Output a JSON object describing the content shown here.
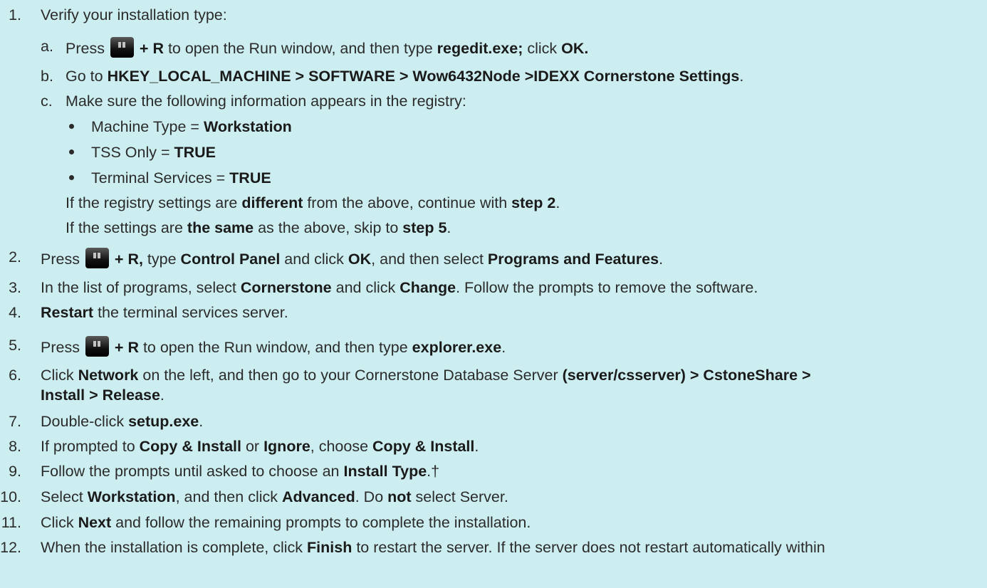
{
  "steps": [
    {
      "n": "1.",
      "parts": [
        {
          "t": "Verify your installation type:"
        }
      ]
    },
    {
      "n": "2.",
      "parts": [
        {
          "t": "Press "
        },
        {
          "icon": "windows-key-icon"
        },
        {
          "t": " + R,",
          "b": 1
        },
        {
          "t": " type "
        },
        {
          "t": "Control Panel",
          "b": 1
        },
        {
          "t": " and click "
        },
        {
          "t": "OK",
          "b": 1
        },
        {
          "t": ", and then select "
        },
        {
          "t": "Programs and Features",
          "b": 1
        },
        {
          "t": "."
        }
      ]
    },
    {
      "n": "3.",
      "parts": [
        {
          "t": "In the list of programs, select "
        },
        {
          "t": "Cornerstone",
          "b": 1
        },
        {
          "t": " and click "
        },
        {
          "t": "Change",
          "b": 1
        },
        {
          "t": ". Follow the prompts to remove the software."
        }
      ]
    },
    {
      "n": "4.",
      "parts": [
        {
          "t": "Restart",
          "b": 1
        },
        {
          "t": " the terminal services server."
        }
      ]
    },
    {
      "n": "5.",
      "parts": [
        {
          "t": "Press "
        },
        {
          "icon": "windows-key-icon"
        },
        {
          "t": " + R",
          "b": 1
        },
        {
          "t": " to open the Run window, and then type "
        },
        {
          "t": "explorer.exe",
          "b": 1
        },
        {
          "t": "."
        }
      ]
    },
    {
      "n": "6.",
      "parts": [
        {
          "t": "Click "
        },
        {
          "t": "Network",
          "b": 1
        },
        {
          "t": " on the left, and then go to your Cornerstone Database Server "
        },
        {
          "t": "(server/csserver) > CstoneShare >",
          "b": 1
        }
      ]
    },
    {
      "n": "",
      "parts": [
        {
          "t": "Install > Release",
          "b": 1
        },
        {
          "t": "."
        }
      ]
    },
    {
      "n": "7.",
      "parts": [
        {
          "t": "Double-click "
        },
        {
          "t": "setup.exe",
          "b": 1
        },
        {
          "t": "."
        }
      ]
    },
    {
      "n": "8.",
      "parts": [
        {
          "t": "If prompted to "
        },
        {
          "t": "Copy & Install",
          "b": 1
        },
        {
          "t": " or "
        },
        {
          "t": "Ignore",
          "b": 1
        },
        {
          "t": ", choose "
        },
        {
          "t": "Copy & Install",
          "b": 1
        },
        {
          "t": "."
        }
      ]
    },
    {
      "n": "9.",
      "parts": [
        {
          "t": "Follow the prompts until asked to choose an "
        },
        {
          "t": "Install Type",
          "b": 1
        },
        {
          "t": ".†"
        }
      ]
    },
    {
      "n": "10.",
      "parts": [
        {
          "t": "Select "
        },
        {
          "t": "Workstation",
          "b": 1
        },
        {
          "t": ", and then click "
        },
        {
          "t": "Advanced",
          "b": 1
        },
        {
          "t": ". Do "
        },
        {
          "t": "not",
          "b": 1
        },
        {
          "t": " select Server."
        }
      ]
    },
    {
      "n": "11.",
      "parts": [
        {
          "t": "Click "
        },
        {
          "t": "Next",
          "b": 1
        },
        {
          "t": " and follow the remaining prompts to complete the installation."
        }
      ]
    },
    {
      "n": "12.",
      "parts": [
        {
          "t": "When the installation is complete, click "
        },
        {
          "t": "Finish",
          "b": 1
        },
        {
          "t": " to restart the server. If the server does not restart automatically within"
        }
      ]
    }
  ],
  "substeps": [
    {
      "n": "a.",
      "parts": [
        {
          "t": "Press "
        },
        {
          "icon": "windows-key-icon"
        },
        {
          "t": " + R",
          "b": 1
        },
        {
          "t": " to open the Run window, and then type "
        },
        {
          "t": "regedit.exe;",
          "b": 1
        },
        {
          "t": " click "
        },
        {
          "t": "OK.",
          "b": 1
        }
      ]
    },
    {
      "n": "b.",
      "parts": [
        {
          "t": "Go to "
        },
        {
          "t": "HKEY_LOCAL_MACHINE > SOFTWARE > Wow6432Node >IDEXX Cornerstone Settings",
          "b": 1
        },
        {
          "t": "."
        }
      ]
    },
    {
      "n": "c.",
      "parts": [
        {
          "t": "Make sure the following information appears in the registry:"
        }
      ]
    }
  ],
  "bullets": [
    {
      "parts": [
        {
          "t": "Machine Type = "
        },
        {
          "t": "Workstation",
          "b": 1
        }
      ]
    },
    {
      "parts": [
        {
          "t": "TSS Only = "
        },
        {
          "t": "TRUE",
          "b": 1
        }
      ]
    },
    {
      "parts": [
        {
          "t": "Terminal Services = "
        },
        {
          "t": "TRUE",
          "b": 1
        }
      ]
    }
  ],
  "notes": [
    {
      "parts": [
        {
          "t": "If the registry settings are "
        },
        {
          "t": "different",
          "b": 1
        },
        {
          "t": " from the above, continue with "
        },
        {
          "t": "step 2",
          "b": 1
        },
        {
          "t": "."
        }
      ]
    },
    {
      "parts": [
        {
          "t": "If the settings are "
        },
        {
          "t": "the same",
          "b": 1
        },
        {
          "t": " as the above, skip to "
        },
        {
          "t": "step 5",
          "b": 1
        },
        {
          "t": "."
        }
      ]
    }
  ]
}
